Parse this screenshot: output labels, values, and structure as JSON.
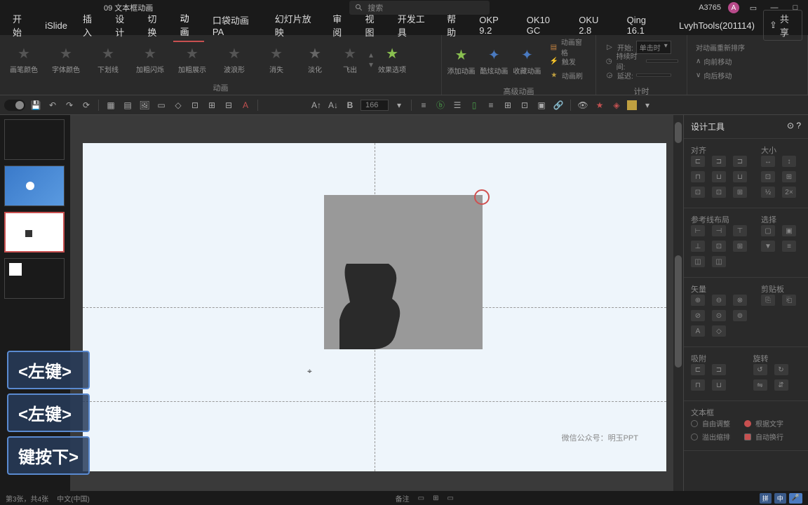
{
  "title_bar": {
    "doc_title": "09 文本框动画",
    "search_placeholder": "搜索",
    "user_code": "A3765",
    "user_initial": "A"
  },
  "menu": {
    "items": [
      "开始",
      "iSlide",
      "插入",
      "设计",
      "切换",
      "动画",
      "口袋动画 PA",
      "幻灯片放映",
      "审阅",
      "视图",
      "开发工具",
      "帮助",
      "OKP 9.2",
      "OK10 GC",
      "OKU 2.8",
      "Qing 16.1",
      "LvyhTools(201114)"
    ],
    "active_index": 5,
    "share_label": "共享"
  },
  "ribbon": {
    "anim_effects": [
      "画笔颜色",
      "字体颜色",
      "下划线",
      "加粗闪烁",
      "加粗展示",
      "波浪形",
      "消失",
      "淡化",
      "飞出"
    ],
    "effect_options": "效果选项",
    "add_anim": "添加动画",
    "cool_anim": "酷炫动画",
    "collect_anim": "收藏动画",
    "anim_group_label": "动画",
    "adv_anim_label": "高级动画",
    "timing_label": "计时",
    "anim_pane": "动画窗格",
    "trigger": "触发",
    "anim_painter": "动画刷",
    "start_label": "开始:",
    "start_value": "单击时",
    "duration_label": "持续时间:",
    "delay_label": "延迟:",
    "reorder_label": "对动画重新排序",
    "move_earlier": "向前移动",
    "move_later": "向后移动"
  },
  "qat": {
    "font_size": "166"
  },
  "slide": {
    "watermark_prefix": "微信公众号：",
    "watermark_name": "明玉PPT"
  },
  "right_panel": {
    "title": "设计工具",
    "align_label": "对齐",
    "size_label": "大小",
    "guides_label": "参考线布局",
    "select_label": "选择",
    "vector_label": "矢量",
    "clipboard_label": "剪贴板",
    "snap_label": "吸附",
    "rotate_label": "旋转",
    "textbox_label": "文本框",
    "free_adjust": "自由调整",
    "fit_text": "根据文字",
    "overflow_shrink": "溢出缩排",
    "auto_wrap": "自动换行"
  },
  "key_overlay": {
    "k1": "<左键>",
    "k2": "<左键>",
    "k3": "键按下>"
  },
  "status": {
    "slide_info": "第3张，共4张",
    "language": "中文(中国)",
    "notes": "备注",
    "lang1": "中"
  }
}
